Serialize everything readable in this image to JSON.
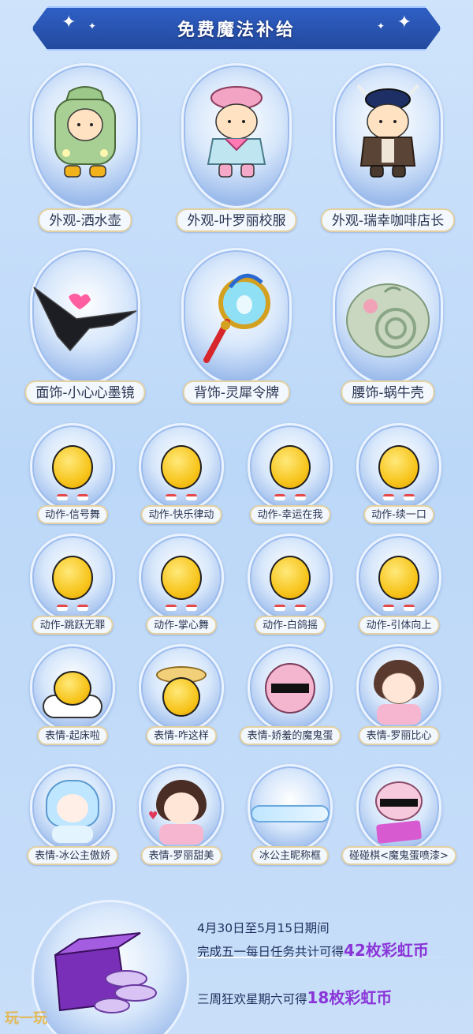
{
  "header": {
    "title": "免费魔法补给"
  },
  "large_items": [
    {
      "label": "外观-洒水壶",
      "icon": "green-watering-can-costume"
    },
    {
      "label": "外观-叶罗丽校服",
      "icon": "pink-school-uniform-costume"
    },
    {
      "label": "外观-瑞幸咖啡店长",
      "icon": "coffee-manager-costume"
    },
    {
      "label": "面饰-小心心墨镜",
      "icon": "heart-sunglasses"
    },
    {
      "label": "背饰-灵犀令牌",
      "icon": "magic-token-wand"
    },
    {
      "label": "腰饰-蜗牛壳",
      "icon": "snail-shell"
    }
  ],
  "small_items": [
    {
      "label": "动作-信号舞",
      "icon": "signal-dance-action"
    },
    {
      "label": "动作-快乐律动",
      "icon": "happy-groove-action"
    },
    {
      "label": "动作-幸运在我",
      "icon": "lucky-me-action"
    },
    {
      "label": "动作-续一口",
      "icon": "one-more-sip-action"
    },
    {
      "label": "动作-跳跃无罪",
      "icon": "jump-action"
    },
    {
      "label": "动作-掌心舞",
      "icon": "palm-dance-action"
    },
    {
      "label": "动作-白鸽摇",
      "icon": "dove-sway-action"
    },
    {
      "label": "动作-引体向上",
      "icon": "pull-up-action"
    },
    {
      "label": "表情-起床啦",
      "icon": "wake-up-emote"
    },
    {
      "label": "表情-咋这样",
      "icon": "why-like-this-emote"
    },
    {
      "label": "表情-娇羞的魔鬼蛋",
      "icon": "shy-devil-egg-emote"
    },
    {
      "label": "表情-罗丽比心",
      "icon": "luoli-heart-emote"
    },
    {
      "label": "表情-冰公主傲娇",
      "icon": "ice-princess-emote"
    },
    {
      "label": "表情-罗丽甜美",
      "icon": "luoli-sweet-emote"
    },
    {
      "label": "冰公主昵称框",
      "icon": "ice-princess-nameplate"
    },
    {
      "label": "碰碰棋<魔鬼蛋喷漆>",
      "icon": "devil-egg-spray"
    }
  ],
  "bottom": {
    "line1": "4月30日至5月15日期间",
    "line2_prefix": "完成五一每日任务共计可得",
    "line2_amount": "42枚彩虹币",
    "line3_prefix": "三周狂欢星期六可得",
    "line3_amount": "18枚彩虹币",
    "accent_color": "#8a35d8",
    "icon": "rainbow-coin-box"
  },
  "watermark": "玩一玩"
}
